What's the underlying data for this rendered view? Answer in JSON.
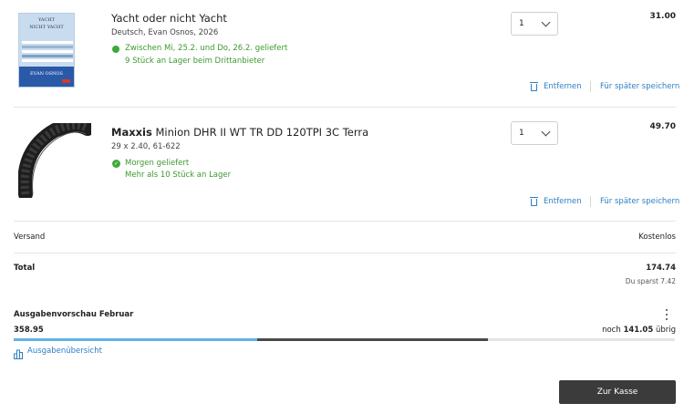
{
  "items": [
    {
      "book_cover": {
        "title_line1": "YACHT",
        "title_line2": "NICHT YACHT",
        "author": "EVAN OSNOS"
      },
      "title_plain": "Yacht oder nicht Yacht",
      "subtitle": "Deutsch, Evan Osnos, 2026",
      "availability_1": "Zwischen Mi, 25.2. und Do, 26.2. geliefert",
      "availability_2": "9 Stück an Lager beim Drittanbieter",
      "quantity": "1",
      "price": "31.00",
      "remove_label": "Entfernen",
      "save_later_label": "Für später speichern"
    },
    {
      "title_brand": "Maxxis",
      "title_rest": " Minion DHR II WT TR DD 120TPI 3C Terra",
      "subtitle": "29 x 2.40, 61-622",
      "availability_1": "Morgen geliefert",
      "availability_2": "Mehr als 10 Stück an Lager",
      "quantity": "1",
      "price": "49.70",
      "remove_label": "Entfernen",
      "save_later_label": "Für später speichern"
    }
  ],
  "shipping": {
    "label": "Versand",
    "value": "Kostenlos"
  },
  "total": {
    "label": "Total",
    "value": "174.74",
    "savings": "Du sparst 7.42"
  },
  "spending_preview": {
    "title": "Ausgabenvorschau Februar",
    "spent": "358.95",
    "remaining_prefix": "noch ",
    "remaining_value": "141.05",
    "remaining_suffix": " übrig",
    "overview_link": "Ausgabenübersicht",
    "segments": [
      {
        "fraction": 0.368,
        "color": "#5fb3e6"
      },
      {
        "fraction": 0.349,
        "color": "#4a4a4a"
      },
      {
        "fraction": 0.283,
        "color": "#e4e4e4"
      }
    ]
  },
  "checkout_button": "Zur Kasse",
  "colors": {
    "accent_link": "#2c7fc4",
    "availability_green": "#3c9a2e",
    "button_dark": "#3b3b3b"
  }
}
